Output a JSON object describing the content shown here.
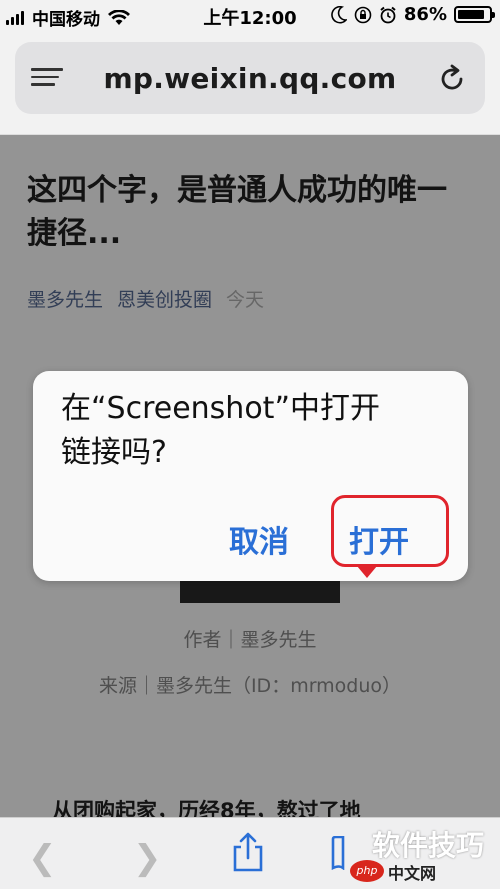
{
  "status_bar": {
    "carrier": "中国移动",
    "time": "上午12:00",
    "battery_percent": "86%",
    "battery_level": 0.86,
    "icons": [
      "signal-icon",
      "wifi-icon",
      "moon-icon",
      "orientation-lock-icon",
      "alarm-icon",
      "battery-icon"
    ]
  },
  "address_bar": {
    "url": "mp.weixin.qq.com"
  },
  "article": {
    "title": "这四个字，是普通人成功的唯一捷径...",
    "author_link": "墨多先生",
    "account_link": "恩美创投圈",
    "date": "今天",
    "author_line": "作者｜墨多先生",
    "source_line": "来源｜墨多先生（ID：mrmoduo）",
    "body_first_line": "从团购起家，历经8年，熬过了地"
  },
  "dialog": {
    "message": "在“Screenshot”中打开链接吗?",
    "cancel_label": "取消",
    "open_label": "打开"
  },
  "toolbar": {
    "icons": [
      "back-icon",
      "forward-icon",
      "share-icon",
      "bookmarks-icon"
    ]
  },
  "watermark": {
    "text": "软件技巧",
    "badge": "php",
    "sub": "中文网"
  },
  "colors": {
    "link": "#576b95",
    "button": "#2a6fd6",
    "highlight": "#e0242c"
  }
}
